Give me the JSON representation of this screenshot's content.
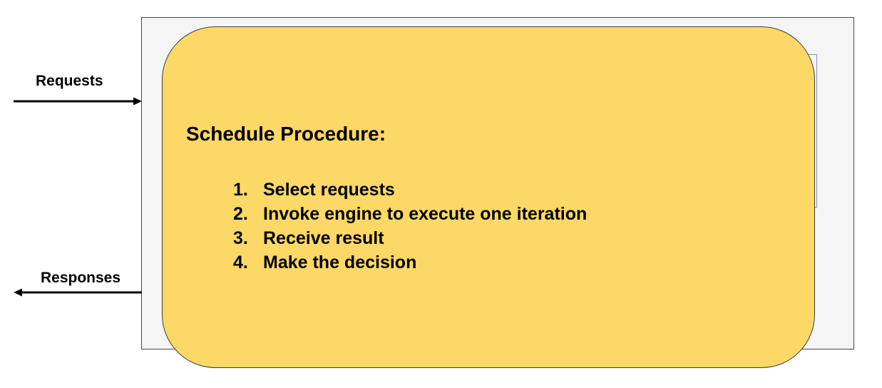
{
  "diagram": {
    "title": "Schedule Procedure:",
    "steps": [
      {
        "number": "1.",
        "text": "Select requests"
      },
      {
        "number": "2.",
        "text": "Invoke engine to execute one iteration"
      },
      {
        "number": "3.",
        "text": "Receive result"
      },
      {
        "number": "4.",
        "text": "Make the decision"
      }
    ],
    "incoming_label": "Requests",
    "outgoing_label": "Responses",
    "colors": {
      "card_fill": "#fcd867",
      "outer_fill": "#f5f5f6",
      "text": "#000000"
    }
  }
}
